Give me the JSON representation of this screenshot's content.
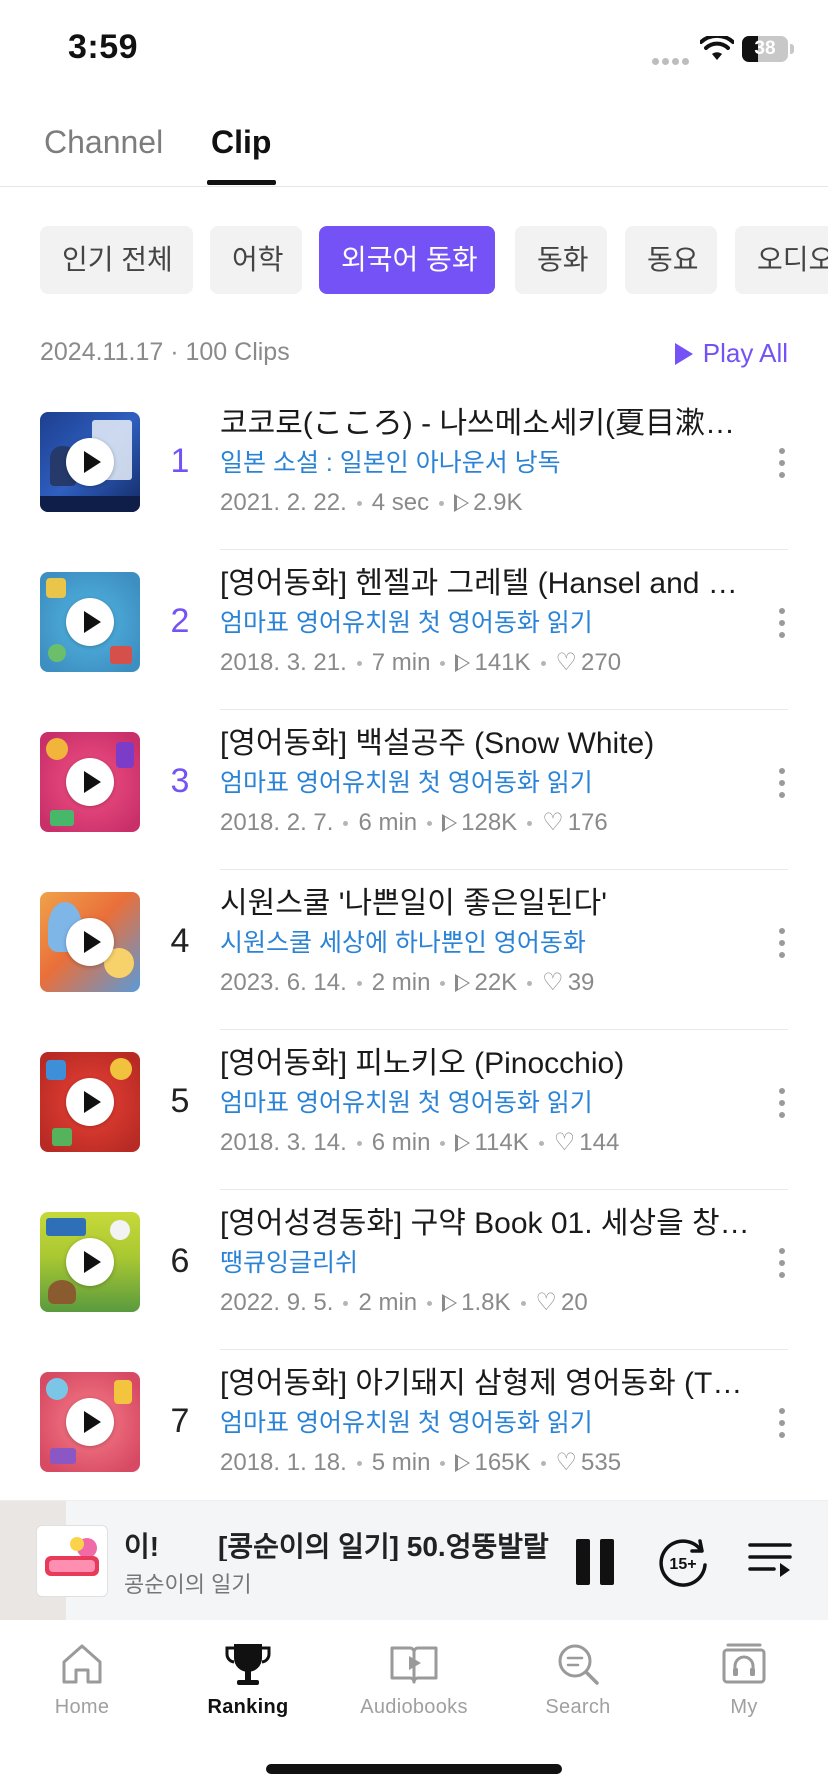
{
  "status_bar": {
    "time": "3:59",
    "battery": "38"
  },
  "tabs": [
    {
      "label": "Channel",
      "active": false
    },
    {
      "label": "Clip",
      "active": true
    }
  ],
  "chips": [
    "인기 전체",
    "어학",
    "외국어 동화",
    "동화",
    "동요",
    "오디오"
  ],
  "active_chip": "외국어 동화",
  "summary": {
    "meta": "2024.11.17 · 100 Clips",
    "play_all": "Play All"
  },
  "clips": [
    {
      "rank": "1",
      "title": "코코로(こころ) - 나쓰메소세키(夏目漱石)...",
      "channel": "일본 소설 : 일본인 아나운서 낭독",
      "date": "2021. 2. 22.",
      "duration": "4 sec",
      "plays": "2.9K",
      "likes": ""
    },
    {
      "rank": "2",
      "title": "[영어동화] 헨젤과 그레텔 (Hansel and G...",
      "channel": "엄마표 영어유치원 첫 영어동화 읽기",
      "date": "2018. 3. 21.",
      "duration": "7 min",
      "plays": "141K",
      "likes": "270"
    },
    {
      "rank": "3",
      "title": "[영어동화] 백설공주 (Snow White)",
      "channel": "엄마표 영어유치원 첫 영어동화 읽기",
      "date": "2018. 2. 7.",
      "duration": "6 min",
      "plays": "128K",
      "likes": "176"
    },
    {
      "rank": "4",
      "title": "시원스쿨 '나쁜일이 좋은일된다'",
      "channel": "시원스쿨 세상에 하나뿐인 영어동화",
      "date": "2023. 6. 14.",
      "duration": "2 min",
      "plays": "22K",
      "likes": "39"
    },
    {
      "rank": "5",
      "title": "[영어동화] 피노키오 (Pinocchio)",
      "channel": "엄마표 영어유치원 첫 영어동화 읽기",
      "date": "2018. 3. 14.",
      "duration": "6 min",
      "plays": "114K",
      "likes": "144"
    },
    {
      "rank": "6",
      "title": "[영어성경동화] 구약 Book 01. 세상을 창…",
      "channel": "땡큐잉글리쉬",
      "date": "2022. 9. 5.",
      "duration": "2 min",
      "plays": "1.8K",
      "likes": "20"
    },
    {
      "rank": "7",
      "title": "[영어동화] 아기돼지 삼형제 영어동화 (Th...",
      "channel": "엄마표 영어유치원 첫 영어동화 읽기",
      "date": "2018. 1. 18.",
      "duration": "5 min",
      "plays": "165K",
      "likes": "535"
    }
  ],
  "mini_player": {
    "title_prefix": "이!",
    "title": "[콩순이의 일기] 50.엉뚱발랄",
    "channel": "콩순이의 일기",
    "skip_label": "15+"
  },
  "bottom_nav": [
    {
      "label": "Home",
      "icon": "home-icon",
      "active": false
    },
    {
      "label": "Ranking",
      "icon": "trophy-icon",
      "active": true
    },
    {
      "label": "Audiobooks",
      "icon": "audiobook-icon",
      "active": false
    },
    {
      "label": "Search",
      "icon": "search-icon",
      "active": false
    },
    {
      "label": "My",
      "icon": "library-icon",
      "active": false
    }
  ],
  "colors": {
    "accent": "#7452f5",
    "link": "#2b83d6",
    "muted": "#8a8a8a"
  }
}
